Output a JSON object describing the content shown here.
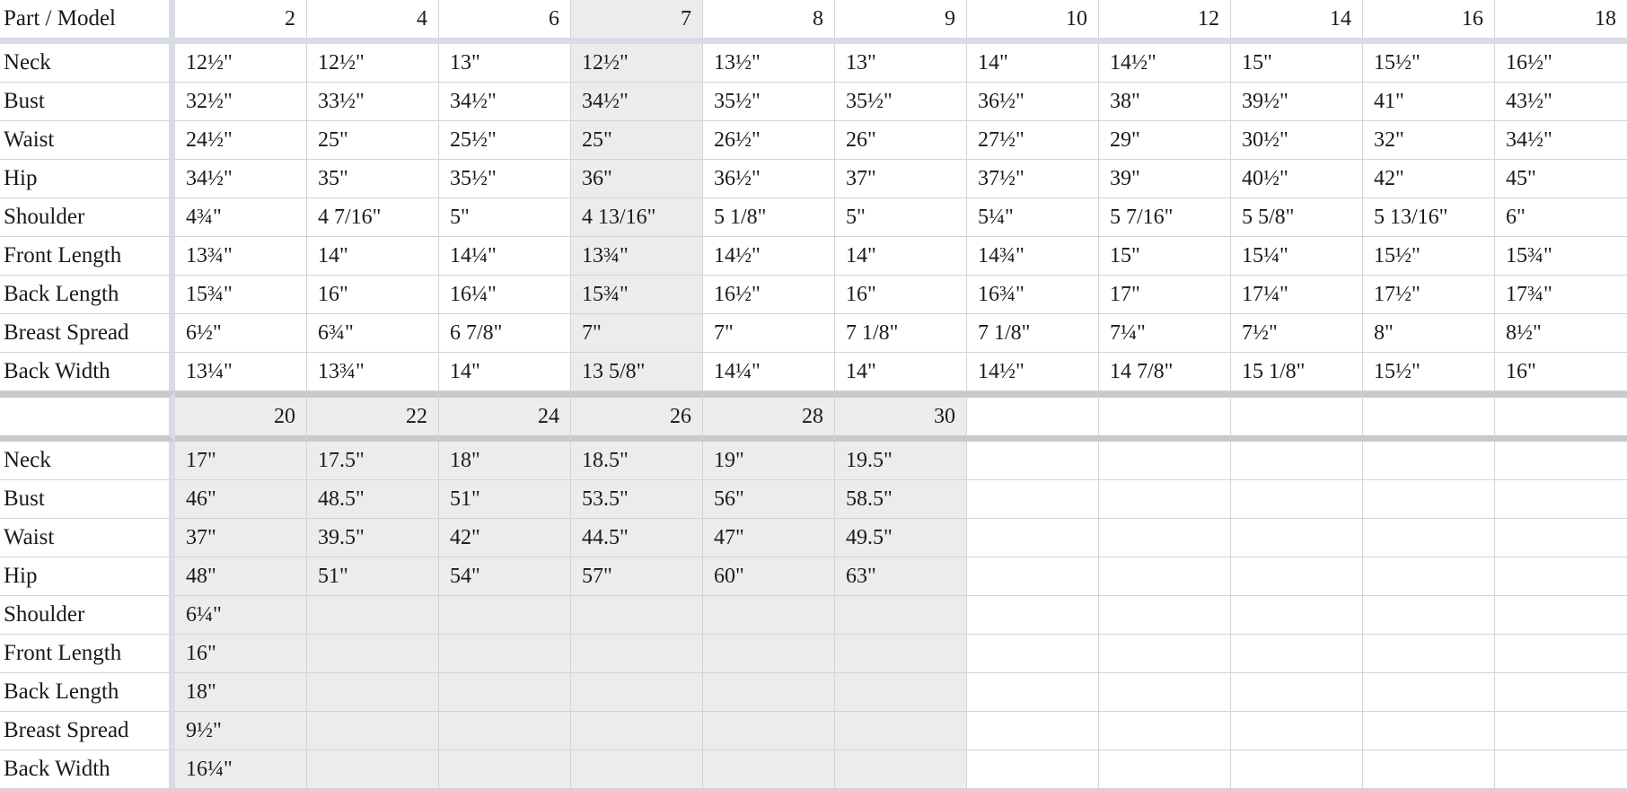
{
  "table": {
    "label_header": "Part / Model",
    "row_labels": [
      "Neck",
      "Bust",
      "Waist",
      "Hip",
      "Shoulder",
      "Front Length",
      "Back Length",
      "Breast Spread",
      "Back Width"
    ],
    "section1": {
      "sizes": [
        "2",
        "4",
        "6",
        "7",
        "8",
        "9",
        "10",
        "12",
        "14",
        "16",
        "18"
      ],
      "highlight_size": "7",
      "rows": [
        {
          "label": "Neck",
          "values": [
            "12½\"",
            "12½\"",
            "13\"",
            "12½\"",
            "13½\"",
            "13\"",
            "14\"",
            "14½\"",
            "15\"",
            "15½\"",
            "16½\""
          ]
        },
        {
          "label": "Bust",
          "values": [
            "32½\"",
            "33½\"",
            "34½\"",
            "34½\"",
            "35½\"",
            "35½\"",
            "36½\"",
            "38\"",
            "39½\"",
            "41\"",
            "43½\""
          ]
        },
        {
          "label": "Waist",
          "values": [
            "24½\"",
            "25\"",
            "25½\"",
            "25\"",
            "26½\"",
            "26\"",
            "27½\"",
            "29\"",
            "30½\"",
            "32\"",
            "34½\""
          ]
        },
        {
          "label": "Hip",
          "values": [
            "34½\"",
            "35\"",
            "35½\"",
            "36\"",
            "36½\"",
            "37\"",
            "37½\"",
            "39\"",
            "40½\"",
            "42\"",
            "45\""
          ]
        },
        {
          "label": "Shoulder",
          "values": [
            "4¾\"",
            "4 7/16\"",
            "5\"",
            "4 13/16\"",
            "5 1/8\"",
            "5\"",
            "5¼\"",
            "5 7/16\"",
            "5 5/8\"",
            "5 13/16\"",
            "6\""
          ]
        },
        {
          "label": "Front Length",
          "values": [
            "13¾\"",
            "14\"",
            "14¼\"",
            "13¾\"",
            "14½\"",
            "14\"",
            "14¾\"",
            "15\"",
            "15¼\"",
            "15½\"",
            "15¾\""
          ]
        },
        {
          "label": "Back Length",
          "values": [
            "15¾\"",
            "16\"",
            "16¼\"",
            "15¾\"",
            "16½\"",
            "16\"",
            "16¾\"",
            "17\"",
            "17¼\"",
            "17½\"",
            "17¾\""
          ]
        },
        {
          "label": "Breast Spread",
          "values": [
            "6½\"",
            "6¾\"",
            "6 7/8\"",
            "7\"",
            "7\"",
            "7 1/8\"",
            "7 1/8\"",
            "7¼\"",
            "7½\"",
            "8\"",
            "8½\""
          ]
        },
        {
          "label": "Back Width",
          "values": [
            "13¼\"",
            "13¾\"",
            "14\"",
            "13 5/8\"",
            "14¼\"",
            "14\"",
            "14½\"",
            "14 7/8\"",
            "15 1/8\"",
            "15½\"",
            "16\""
          ]
        }
      ]
    },
    "section2": {
      "sizes": [
        "20",
        "22",
        "24",
        "26",
        "28",
        "30",
        "",
        "",
        "",
        "",
        ""
      ],
      "rows": [
        {
          "label": "Neck",
          "values": [
            "17\"",
            "17.5\"",
            "18\"",
            "18.5\"",
            "19\"",
            "19.5\"",
            "",
            "",
            "",
            "",
            ""
          ]
        },
        {
          "label": "Bust",
          "values": [
            "46\"",
            "48.5\"",
            "51\"",
            "53.5\"",
            "56\"",
            "58.5\"",
            "",
            "",
            "",
            "",
            ""
          ]
        },
        {
          "label": "Waist",
          "values": [
            "37\"",
            "39.5\"",
            "42\"",
            "44.5\"",
            "47\"",
            "49.5\"",
            "",
            "",
            "",
            "",
            ""
          ]
        },
        {
          "label": "Hip",
          "values": [
            "48\"",
            "51\"",
            "54\"",
            "57\"",
            "60\"",
            "63\"",
            "",
            "",
            "",
            "",
            ""
          ]
        },
        {
          "label": "Shoulder",
          "values": [
            "6¼\"",
            "",
            "",
            "",
            "",
            "",
            "",
            "",
            "",
            "",
            ""
          ]
        },
        {
          "label": "Front Length",
          "values": [
            "16\"",
            "",
            "",
            "",
            "",
            "",
            "",
            "",
            "",
            "",
            ""
          ]
        },
        {
          "label": "Back Length",
          "values": [
            "18\"",
            "",
            "",
            "",
            "",
            "",
            "",
            "",
            "",
            "",
            ""
          ]
        },
        {
          "label": "Breast Spread",
          "values": [
            "9½\"",
            "",
            "",
            "",
            "",
            "",
            "",
            "",
            "",
            "",
            ""
          ]
        },
        {
          "label": "Back Width",
          "values": [
            "16¼\"",
            "",
            "",
            "",
            "",
            "",
            "",
            "",
            "",
            "",
            ""
          ]
        }
      ]
    }
  },
  "colors": {
    "grid": "#d4d4d4",
    "divider": "#d8dce4",
    "section_band": "#c9c9c9",
    "highlight": "#ececec",
    "text": "#1a1a1a",
    "background": "#ffffff"
  }
}
